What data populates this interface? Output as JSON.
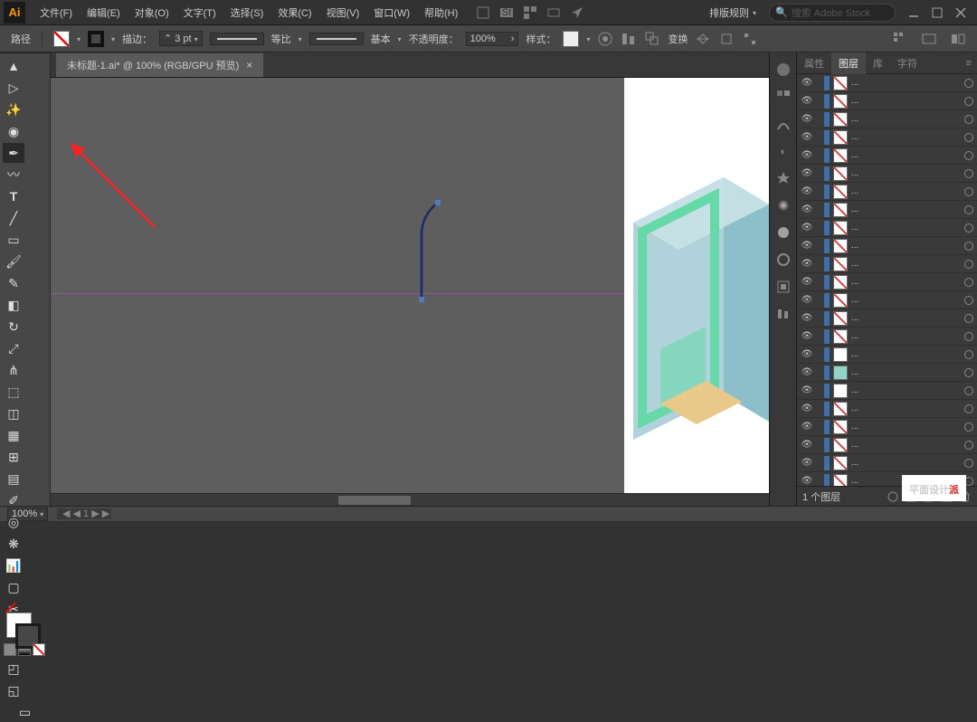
{
  "app": {
    "logo": "Ai"
  },
  "menus": [
    "文件(F)",
    "编辑(E)",
    "对象(O)",
    "文字(T)",
    "选择(S)",
    "效果(C)",
    "视图(V)",
    "窗口(W)",
    "帮助(H)"
  ],
  "workspace": {
    "label": "排版规则",
    "search_placeholder": "搜索 Adobe Stock"
  },
  "optbar": {
    "tool": "路径",
    "stroke_label": "描边：",
    "stroke_width": "3 pt",
    "even_label": "等比",
    "basic_label": "基本",
    "opacity_label": "不透明度：",
    "opacity_value": "100%",
    "style_label": "样式：",
    "transform_label": "变换"
  },
  "tab": {
    "title": "未标题-1.ai* @ 100% (RGB/GPU 预览)"
  },
  "panels": {
    "tabs": [
      "属性",
      "图层",
      "库",
      "字符"
    ],
    "active": 1
  },
  "layer_rows_count": 24,
  "layer_name": "...",
  "layer_footer": {
    "count": "1 个图层"
  },
  "status": {
    "zoom": "100%"
  },
  "watermark": {
    "a": "平面设计",
    "b": "派"
  },
  "colors": {
    "accent": "#ff9a00",
    "bg": "#323232",
    "panel": "#474747"
  }
}
